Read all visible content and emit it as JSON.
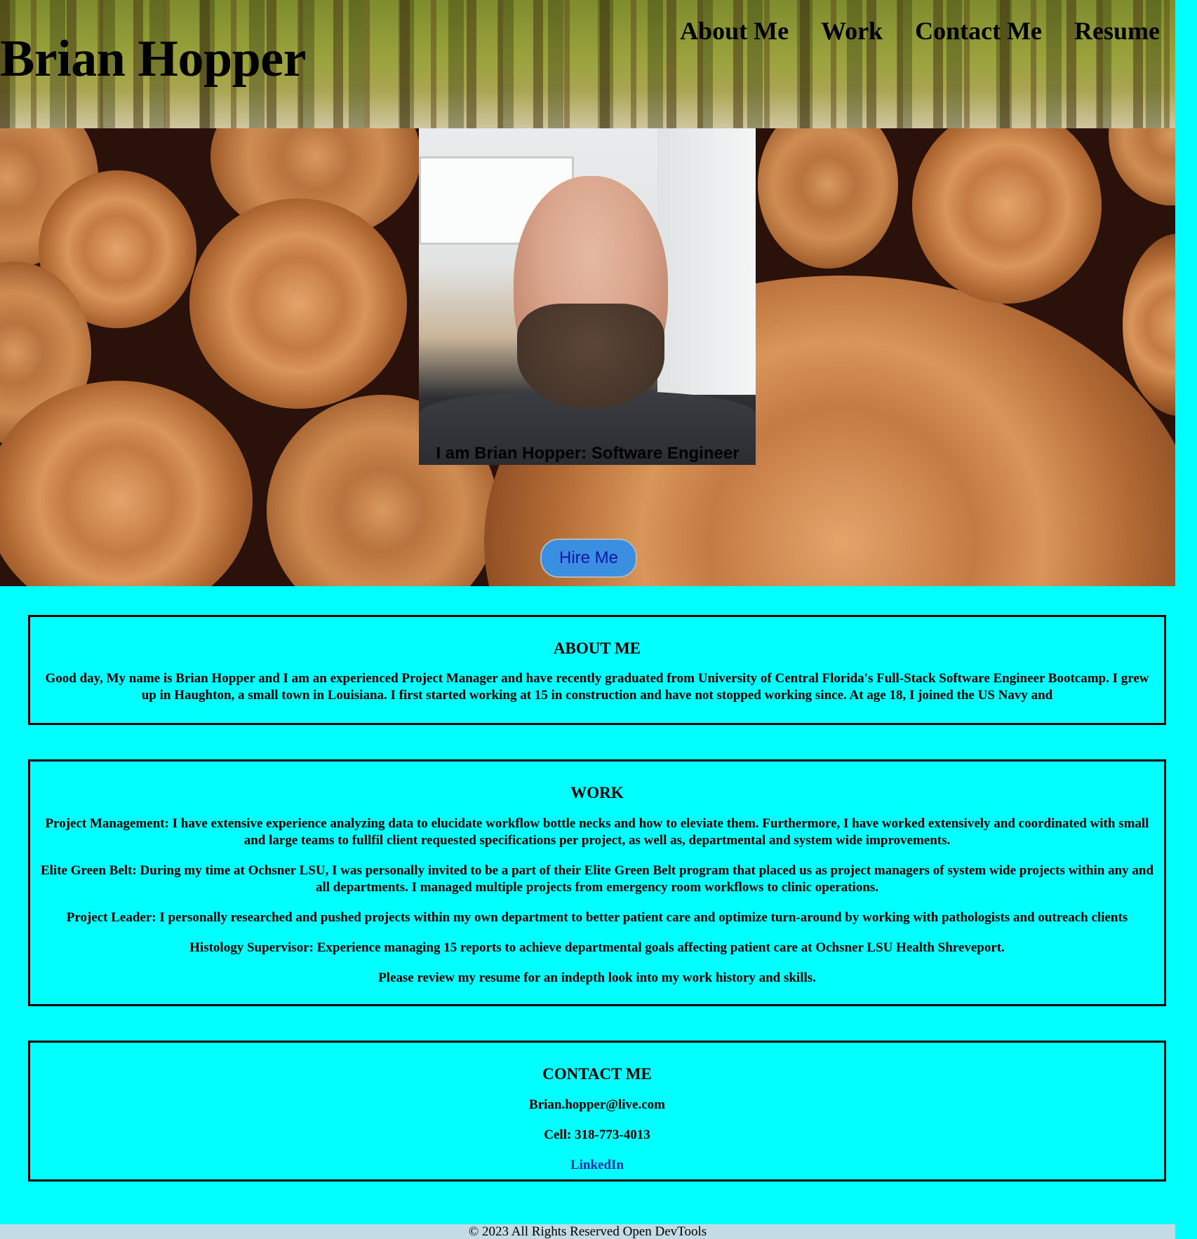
{
  "header": {
    "title": "Brian Hopper",
    "nav": [
      "About Me",
      "Work",
      "Contact Me",
      "Resume"
    ]
  },
  "hero": {
    "tagline": "I am Brian Hopper: Software Engineer",
    "button": "Hire Me"
  },
  "about": {
    "heading": "ABOUT ME",
    "text": "Good day, My name is Brian Hopper and I am an experienced Project Manager and have recently graduated from University of Central Florida's Full-Stack Software Engineer Bootcamp. I grew up in Haughton, a small town in Louisiana. I first started working at 15 in construction and have not stopped working since. At age 18, I joined the US Navy and"
  },
  "work": {
    "heading": "WORK",
    "items": [
      "Project Management: I have extensive experience analyzing data to elucidate workflow bottle necks and how to eleviate them. Furthermore, I have worked extensively and coordinated with small and large teams to fullfil client requested specifications per project, as well as, departmental and system wide improvements.",
      "Elite Green Belt: During my time at Ochsner LSU, I was personally invited to be a part of their Elite Green Belt program that placed us as project managers of system wide projects within any and all departments. I managed multiple projects from emergency room workflows to clinic operations.",
      "Project Leader: I personally researched and pushed projects within my own department to better patient care and optimize turn-around by working with pathologists and outreach clients",
      "Histology Supervisor: Experience managing 15 reports to achieve departmental goals affecting patient care at Ochsner LSU Health Shreveport.",
      "Please review my resume for an indepth look into my work history and skills."
    ]
  },
  "contact": {
    "heading": "CONTACT ME",
    "email": "Brian.hopper@live.com",
    "cell": "Cell: 318-773-4013",
    "linkedin": "LinkedIn"
  },
  "footer": {
    "text": "© 2023 All Rights Reserved Open DevTools"
  },
  "colors": {
    "page_background": "#00ffff",
    "hire_button": "#3a8fe0",
    "footer_background": "#c3dbe4",
    "link": "#1a2aa8"
  }
}
